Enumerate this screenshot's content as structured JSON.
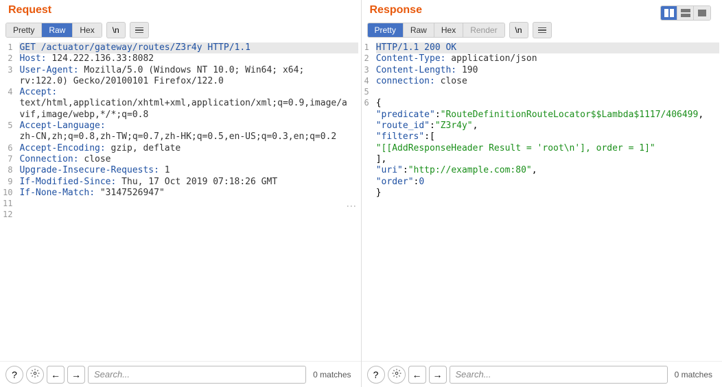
{
  "layout_buttons": [
    "split-vertical",
    "split-horizontal",
    "single"
  ],
  "request": {
    "title": "Request",
    "tabs": [
      {
        "label": "Pretty",
        "active": false
      },
      {
        "label": "Raw",
        "active": true
      },
      {
        "label": "Hex",
        "active": false
      }
    ],
    "newline_btn": "\\n",
    "lines": [
      {
        "n": 1,
        "raw": true,
        "hl": true,
        "text": "GET /actuator/gateway/routes/Z3r4y HTTP/1.1"
      },
      {
        "n": 2,
        "key": "Host:",
        "val": " 124.222.136.33:8082"
      },
      {
        "n": 3,
        "key": "User-Agent:",
        "val": " Mozilla/5.0 (Windows NT 10.0; Win64; x64;"
      },
      {
        "n": "",
        "cont": true,
        "val": "rv:122.0) Gecko/20100101 Firefox/122.0"
      },
      {
        "n": 4,
        "key": "Accept:",
        "val": ""
      },
      {
        "n": "",
        "cont": true,
        "val": "text/html,application/xhtml+xml,application/xml;q=0.9,image/a"
      },
      {
        "n": "",
        "cont": true,
        "val": "vif,image/webp,*/*;q=0.8"
      },
      {
        "n": 5,
        "key": "Accept-Language:",
        "val": ""
      },
      {
        "n": "",
        "cont": true,
        "val": "zh-CN,zh;q=0.8,zh-TW;q=0.7,zh-HK;q=0.5,en-US;q=0.3,en;q=0.2"
      },
      {
        "n": 6,
        "key": "Accept-Encoding:",
        "val": " gzip, deflate"
      },
      {
        "n": 7,
        "key": "Connection:",
        "val": " close"
      },
      {
        "n": 8,
        "key": "Upgrade-Insecure-Requests:",
        "val": " 1"
      },
      {
        "n": 9,
        "key": "If-Modified-Since:",
        "val": " Thu, 17 Oct 2019 07:18:26 GMT"
      },
      {
        "n": 10,
        "key": "If-None-Match:",
        "val": " \"3147526947\""
      },
      {
        "n": 11,
        "raw": true,
        "text": ""
      },
      {
        "n": 12,
        "raw": true,
        "text": ""
      }
    ],
    "search_placeholder": "Search...",
    "matches": "0 matches"
  },
  "response": {
    "title": "Response",
    "tabs": [
      {
        "label": "Pretty",
        "active": true
      },
      {
        "label": "Raw",
        "active": false
      },
      {
        "label": "Hex",
        "active": false
      },
      {
        "label": "Render",
        "active": false,
        "disabled": true
      }
    ],
    "newline_btn": "\\n",
    "lines": [
      {
        "n": 1,
        "raw": true,
        "hl": true,
        "text": "HTTP/1.1 200 OK"
      },
      {
        "n": 2,
        "key": "Content-Type:",
        "val": " application/json"
      },
      {
        "n": 3,
        "key": "Content-Length:",
        "val": " 190"
      },
      {
        "n": 4,
        "key": "connection:",
        "val": " close"
      },
      {
        "n": 5,
        "raw": true,
        "text": ""
      },
      {
        "n": 6,
        "raw": true,
        "text": "{"
      },
      {
        "n": "",
        "jkey": "\"predicate\"",
        "jval": "\"RouteDefinitionRouteLocator$$Lambda$1117/406499",
        "comma": true,
        "indent": 4
      },
      {
        "n": "",
        "jkey": "\"route_id\"",
        "jval": "\"Z3r4y\"",
        "comma": true,
        "indent": 4
      },
      {
        "n": "",
        "jkey": "\"filters\"",
        "jraw": "[",
        "indent": 4
      },
      {
        "n": "",
        "jstr": "\"[[AddResponseHeader Result = 'root\\n'], order = 1]\"",
        "indent": 8
      },
      {
        "n": "",
        "jraw2": "],",
        "indent": 4
      },
      {
        "n": "",
        "jkey": "\"uri\"",
        "jval": "\"http://example.com:80\"",
        "comma": true,
        "indent": 4
      },
      {
        "n": "",
        "jkey": "\"order\"",
        "jnum": "0",
        "indent": 4
      },
      {
        "n": "",
        "raw": true,
        "text": "}"
      }
    ],
    "search_placeholder": "Search...",
    "matches": "0 matches"
  }
}
